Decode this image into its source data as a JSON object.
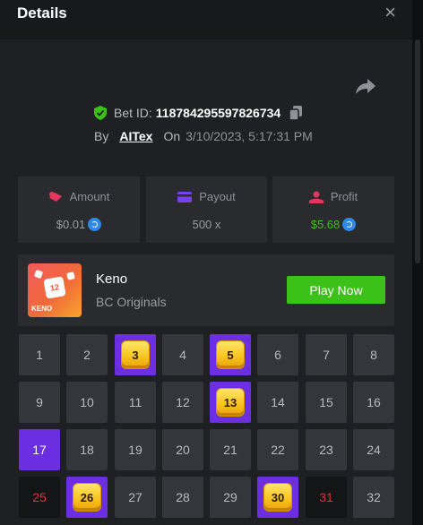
{
  "modal": {
    "title": "Details",
    "close_glyph": "×"
  },
  "bet": {
    "label": "Bet ID:",
    "id": "118784295597826734",
    "by_label": "By",
    "user": "AITex",
    "on_label": "On",
    "date": "3/10/2023, 5:17:31 PM"
  },
  "stats": {
    "amount": {
      "label": "Amount",
      "value": "$0.01",
      "icon": "amount-icon"
    },
    "payout": {
      "label": "Payout",
      "value": "500 x",
      "icon": "card-icon"
    },
    "profit": {
      "label": "Profit",
      "value": "$5.68",
      "icon": "profit-icon",
      "color": "#3bc117"
    }
  },
  "game": {
    "name": "Keno",
    "provider": "BC Originals",
    "thumb_label": "KENO",
    "thumb_ball": "12",
    "play_label": "Play Now"
  },
  "colors": {
    "accent": "#6b2ee0",
    "play": "#3bc117",
    "miss": "#e0333a"
  },
  "grid": [
    {
      "n": "1",
      "state": "normal"
    },
    {
      "n": "2",
      "state": "normal"
    },
    {
      "n": "3",
      "state": "hit"
    },
    {
      "n": "4",
      "state": "normal"
    },
    {
      "n": "5",
      "state": "hit"
    },
    {
      "n": "6",
      "state": "normal"
    },
    {
      "n": "7",
      "state": "normal"
    },
    {
      "n": "8",
      "state": "normal"
    },
    {
      "n": "9",
      "state": "normal"
    },
    {
      "n": "10",
      "state": "normal"
    },
    {
      "n": "11",
      "state": "normal"
    },
    {
      "n": "12",
      "state": "normal"
    },
    {
      "n": "13",
      "state": "hit"
    },
    {
      "n": "14",
      "state": "normal"
    },
    {
      "n": "15",
      "state": "normal"
    },
    {
      "n": "16",
      "state": "normal"
    },
    {
      "n": "17",
      "state": "picked"
    },
    {
      "n": "18",
      "state": "normal"
    },
    {
      "n": "19",
      "state": "normal"
    },
    {
      "n": "20",
      "state": "normal"
    },
    {
      "n": "21",
      "state": "normal"
    },
    {
      "n": "22",
      "state": "normal"
    },
    {
      "n": "23",
      "state": "normal"
    },
    {
      "n": "24",
      "state": "normal"
    },
    {
      "n": "25",
      "state": "miss"
    },
    {
      "n": "26",
      "state": "hit"
    },
    {
      "n": "27",
      "state": "normal"
    },
    {
      "n": "28",
      "state": "normal"
    },
    {
      "n": "29",
      "state": "normal"
    },
    {
      "n": "30",
      "state": "hit"
    },
    {
      "n": "31",
      "state": "miss"
    },
    {
      "n": "32",
      "state": "normal"
    }
  ]
}
